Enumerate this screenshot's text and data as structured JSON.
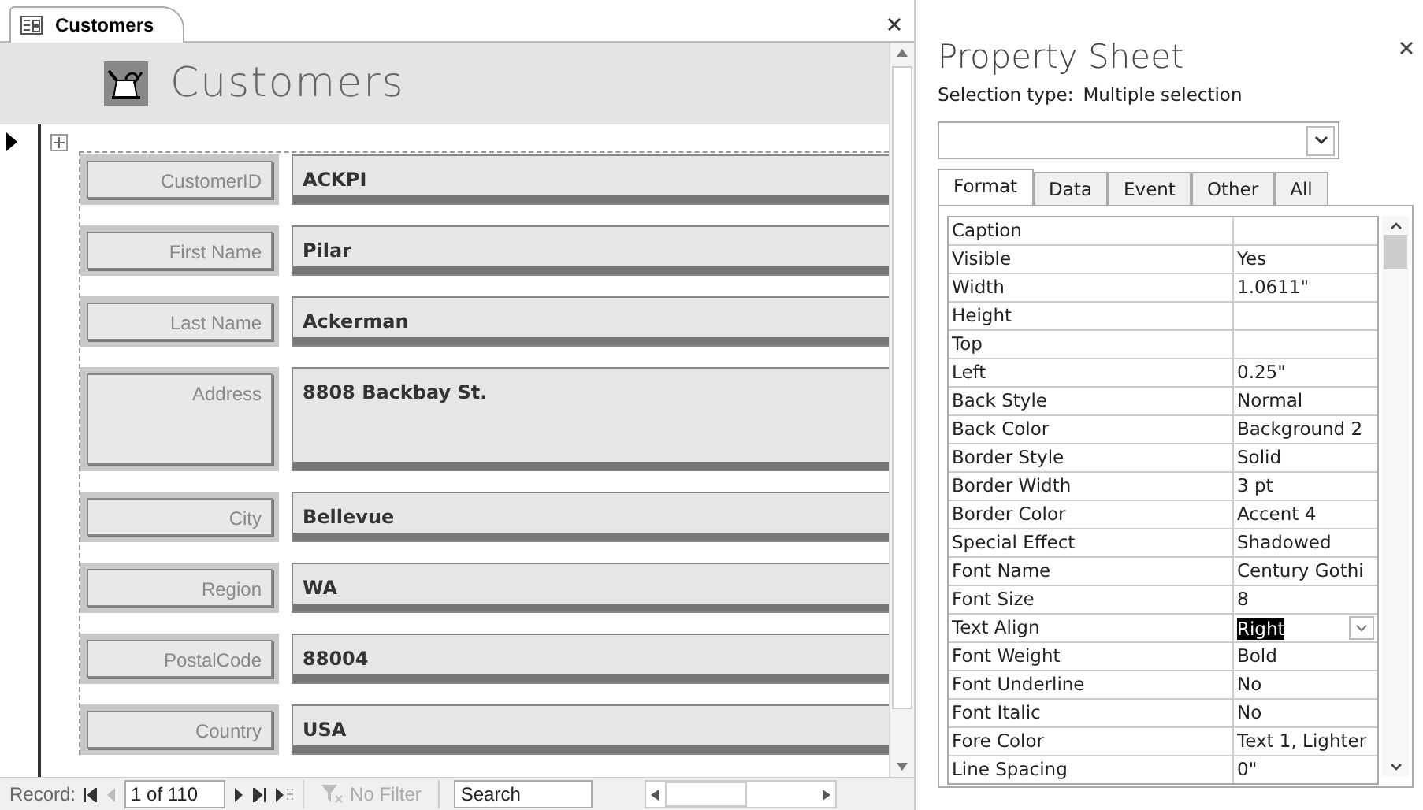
{
  "document_tab": {
    "label": "Customers"
  },
  "form": {
    "title": "Customers",
    "fields": [
      {
        "label": "CustomerID",
        "value": "ACKPI",
        "kind": "short"
      },
      {
        "label": "First Name",
        "value": "Pilar",
        "kind": "short"
      },
      {
        "label": "Last Name",
        "value": "Ackerman",
        "kind": "short"
      },
      {
        "label": "Address",
        "value": "8808 Backbay St.",
        "kind": "tall"
      },
      {
        "label": "City",
        "value": "Bellevue",
        "kind": "short"
      },
      {
        "label": "Region",
        "value": "WA",
        "kind": "short"
      },
      {
        "label": "PostalCode",
        "value": "88004",
        "kind": "short"
      },
      {
        "label": "Country",
        "value": "USA",
        "kind": "short"
      }
    ]
  },
  "navigation": {
    "label": "Record:",
    "position": "1 of 110",
    "filter": "No Filter",
    "filter_disabled": true,
    "search": {
      "placeholder": "Search"
    }
  },
  "property_sheet": {
    "title": "Property Sheet",
    "selection_label": "Selection type:",
    "selection_type": "Multiple selection",
    "tabs": [
      {
        "label": "Format",
        "selected": true
      },
      {
        "label": "Data",
        "selected": false
      },
      {
        "label": "Event",
        "selected": false
      },
      {
        "label": "Other",
        "selected": false
      },
      {
        "label": "All",
        "selected": false
      }
    ],
    "properties": [
      {
        "name": "Caption",
        "selected": false
      },
      {
        "name": "Visible",
        "value": "Yes",
        "selected": false
      },
      {
        "name": "Width",
        "value": "1.0611\"",
        "selected": false
      },
      {
        "name": "Height",
        "selected": false
      },
      {
        "name": "Top",
        "selected": false
      },
      {
        "name": "Left",
        "value": "0.25\"",
        "selected": false
      },
      {
        "name": "Back Style",
        "value": "Normal",
        "selected": false
      },
      {
        "name": "Back Color",
        "value": "Background 2",
        "selected": false
      },
      {
        "name": "Border Style",
        "value": "Solid",
        "selected": false
      },
      {
        "name": "Border Width",
        "value": "3 pt",
        "selected": false
      },
      {
        "name": "Border Color",
        "value": "Accent 4",
        "selected": false
      },
      {
        "name": "Special Effect",
        "value": "Shadowed",
        "selected": false
      },
      {
        "name": "Font Name",
        "value": "Century Gothi",
        "selected": false
      },
      {
        "name": "Font Size",
        "value": "8",
        "selected": false
      },
      {
        "name": "Text Align",
        "value": "Right",
        "selected": true
      },
      {
        "name": "Font Weight",
        "value": "Bold",
        "selected": false
      },
      {
        "name": "Font Underline",
        "value": "No",
        "selected": false
      },
      {
        "name": "Font Italic",
        "value": "No",
        "selected": false
      },
      {
        "name": "Fore Color",
        "value": "Text 1, Lighter",
        "selected": false
      },
      {
        "name": "Line Spacing",
        "value": "0\"",
        "selected": false
      }
    ]
  }
}
